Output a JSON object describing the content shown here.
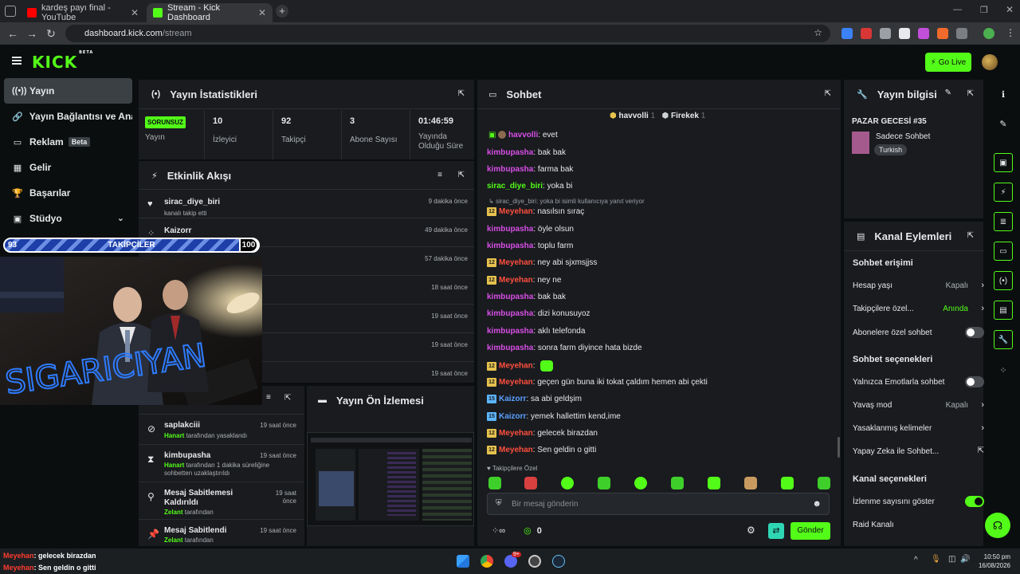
{
  "browser": {
    "tabs": [
      {
        "title": "kardeş payı final - YouTube",
        "active": false
      },
      {
        "title": "Stream - Kick Dashboard",
        "active": true
      }
    ],
    "url_host": "dashboard.kick.com",
    "url_path": "/stream"
  },
  "app": {
    "logo": "KICK",
    "logo_tag": "BETA",
    "go_live": "Go Live",
    "accent": "#53fc18"
  },
  "sidebar": {
    "items": [
      {
        "label": "Yayın",
        "icon": "stream-icon"
      },
      {
        "label": "Yayın Bağlantısı ve Anahtarı",
        "icon": "link-icon"
      },
      {
        "label": "Reklam",
        "icon": "ad-icon",
        "badge": "Beta"
      },
      {
        "label": "Gelir",
        "icon": "revenue-icon"
      },
      {
        "label": "Başarılar",
        "icon": "trophy-icon"
      },
      {
        "label": "Stüdyo",
        "icon": "studio-icon"
      }
    ]
  },
  "overlay": {
    "follower_start": "93",
    "follower_label": "TAKİPÇİLER",
    "follower_goal": "100",
    "image_text": "SIGARICIYAN"
  },
  "stats": {
    "title": "Yayın İstatistikleri",
    "status_badge": "SORUNSUZ",
    "status_label": "Yayın",
    "viewers": "10",
    "viewers_label": "İzleyici",
    "followers": "92",
    "followers_label": "Takipçi",
    "subs": "3",
    "subs_label": "Abone Sayısı",
    "uptime": "01:46:59",
    "uptime_label_1": "Yayında",
    "uptime_label_2": "Olduğu Süre"
  },
  "activity": {
    "title": "Etkinlik Akışı",
    "rows": [
      {
        "name": "sirac_diye_biri",
        "sub": "kanalı takip etti",
        "time": "9 dakika önce"
      },
      {
        "name": "Kaizorr",
        "sub": "",
        "time": "49 dakika önce"
      },
      {
        "name": "",
        "sub": "",
        "time": "57 dakika önce"
      },
      {
        "name": "",
        "sub": "",
        "time": "18 saat önce"
      },
      {
        "name": "",
        "sub": "",
        "time": "19 saat önce"
      },
      {
        "name": "",
        "sub": "",
        "time": "19 saat önce"
      },
      {
        "name": "",
        "sub": "",
        "time": "19 saat önce"
      }
    ]
  },
  "modlog": {
    "rows": [
      {
        "name": "saplakciii",
        "actor": "Hanart",
        "sub": "tarafından yasaklandı",
        "time": "19 saat önce"
      },
      {
        "name": "kimbupasha",
        "actor": "Hanart",
        "sub": "tarafından 1 dakika süreliğine",
        "sub2": "sohbetten uzaklaştırıldı",
        "time": "19 saat önce"
      },
      {
        "name": "Mesaj Sabitlemesi",
        "name2": "Kaldırıldı",
        "actor": "Zelant",
        "sub": "tarafından",
        "time": "19 saat",
        "time2": "önce"
      },
      {
        "name": "Mesaj Sabitlendi",
        "actor": "Zelant",
        "sub": "tarafından",
        "time": "19 saat önce"
      }
    ]
  },
  "preview": {
    "title": "Yayın Ön İzlemesi"
  },
  "chat": {
    "title": "Sohbet",
    "top_users": [
      {
        "name": "havvolli",
        "count": "1"
      },
      {
        "name": "Firekek",
        "count": "1"
      }
    ],
    "messages": [
      {
        "user": "havvolli",
        "text": "evet",
        "color": "u-green",
        "badge": ""
      },
      {
        "user": "kimbupasha",
        "text": "bak bak",
        "color": "u-pink",
        "badge": ""
      },
      {
        "user": "kimbupasha",
        "text": "farma bak",
        "color": "u-pink",
        "badge": ""
      },
      {
        "user": "sirac_diye_biri",
        "text": "yoka bi",
        "color": "u-green",
        "badge": ""
      },
      {
        "user": "Meyehan",
        "text": "nasılsın sıraç",
        "color": "u-red",
        "badge": "12"
      },
      {
        "user": "kimbupasha",
        "text": "öyle olsun",
        "color": "u-pink",
        "badge": ""
      },
      {
        "user": "kimbupasha",
        "text": "toplu farm",
        "color": "u-pink",
        "badge": ""
      },
      {
        "user": "Meyehan",
        "text": "ney abi sjxmsjjss",
        "color": "u-red",
        "badge": "12"
      },
      {
        "user": "Meyehan",
        "text": "ney ne",
        "color": "u-red",
        "badge": "12"
      },
      {
        "user": "kimbupasha",
        "text": "bak bak",
        "color": "u-pink",
        "badge": ""
      },
      {
        "user": "kimbupasha",
        "text": "dizi konusuyoz",
        "color": "u-pink",
        "badge": ""
      },
      {
        "user": "kimbupasha",
        "text": "aklı telefonda",
        "color": "u-pink",
        "badge": ""
      },
      {
        "user": "kimbupasha",
        "text": "sonra farm diyince hata bizde",
        "color": "u-pink",
        "badge": ""
      },
      {
        "user": "Meyehan",
        "text": "",
        "color": "u-red",
        "badge": "12"
      },
      {
        "user": "Meyehan",
        "text": "geçen gün buna iki tokat çaldım hemen abi çekti",
        "color": "u-red",
        "badge": "12"
      },
      {
        "user": "Kaizorr",
        "text": "sa abi geldşim",
        "color": "u-blue",
        "badge": "15"
      },
      {
        "user": "Kaizorr",
        "text": "yemek hallettim kend,ime",
        "color": "u-blue",
        "badge": "15"
      },
      {
        "user": "Meyehan",
        "text": "gelecek birazdan",
        "color": "u-red",
        "badge": "12"
      },
      {
        "user": "Meyehan",
        "text": "Sen geldin o gitti",
        "color": "u-red",
        "badge": "12"
      }
    ],
    "reply_hint": "sirac_diye_biri: yoka bi isimli kullanıcıya yanıt veriyor",
    "followers_only": "Takipçilere Özel",
    "input_placeholder": "Bir mesaj gönderin",
    "points": "0",
    "send": "Gönder"
  },
  "stream_info": {
    "title": "Yayın bilgisi",
    "stream_title": "PAZAR GECESİ #35",
    "category": "Sadece Sohbet",
    "language": "Turkish"
  },
  "channel_actions": {
    "title": "Kanal Eylemleri",
    "chat_access": "Sohbet erişimi",
    "account_age": "Hesap yaşı",
    "account_age_val": "Kapalı",
    "followers_only": "Takipçilere özel...",
    "followers_only_val": "Anında",
    "subs_only": "Abonelere özel sohbet",
    "chat_options": "Sohbet seçenekleri",
    "emote_only": "Yalnızca Emotlarla sohbet",
    "slow_mode": "Yavaş mod",
    "slow_mode_val": "Kapalı",
    "banned_words": "Yasaklanmış kelimeler",
    "ai_chat": "Yapay Zeka ile Sohbet...",
    "channel_options": "Kanal seçenekleri",
    "show_viewers": "İzlenme sayısını göster",
    "raid": "Raid Kanalı"
  },
  "taskbar_chat": [
    {
      "user": "Meyehan",
      "text": ": gelecek birazdan"
    },
    {
      "user": "Meyehan",
      "text": ": Sen geldin o gitti"
    }
  ],
  "system": {
    "time": "10:50 pm",
    "date": "16/08/2026",
    "badge": "9+"
  }
}
